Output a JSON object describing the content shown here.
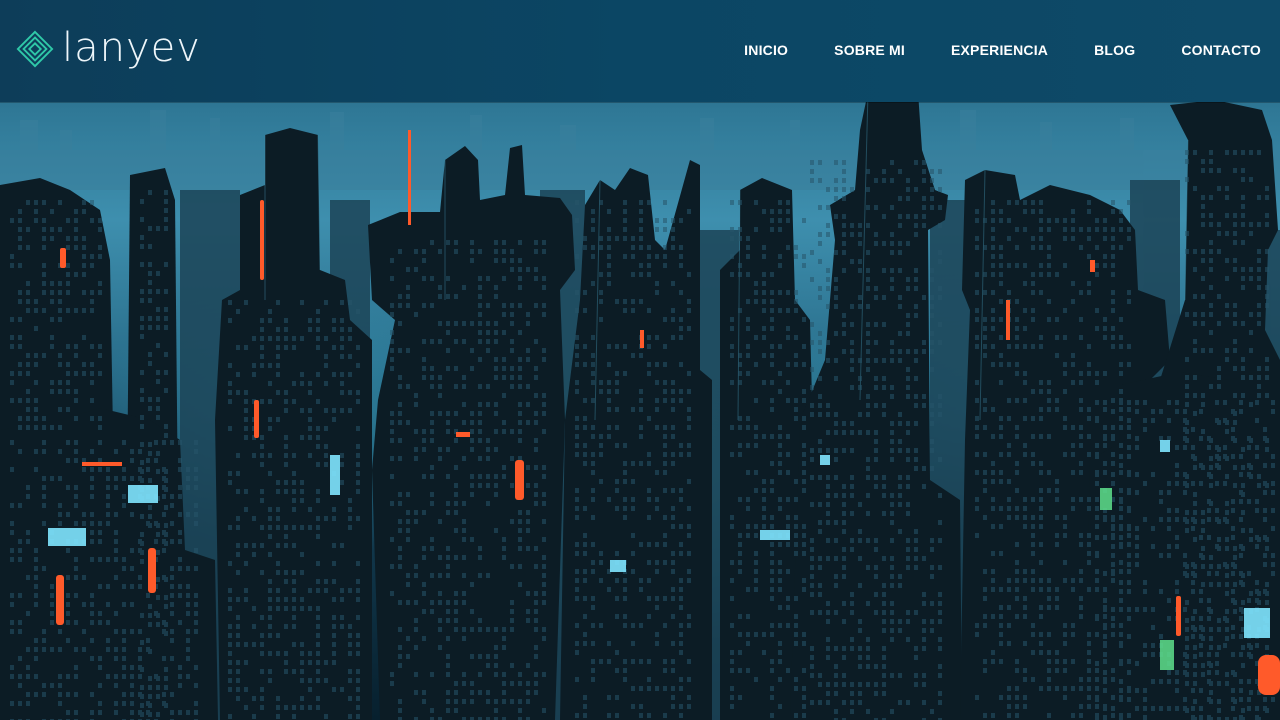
{
  "header": {
    "logo_text": "lanyev",
    "logo_icon": "diamond-icon",
    "nav": [
      {
        "label": "INICIO"
      },
      {
        "label": "SOBRE MI"
      },
      {
        "label": "EXPERIENCIA"
      },
      {
        "label": "BLOG"
      },
      {
        "label": "CONTACTO"
      }
    ]
  },
  "hero": {
    "image": "cyberpunk-city-skyline",
    "colors": {
      "sky": "#3e8fae",
      "building": "#0b1a22",
      "light_orange": "#ff5a2a",
      "light_cyan": "#7fe6ff",
      "header": "#0b4664",
      "logo_accent": "#2fc9a8"
    }
  }
}
